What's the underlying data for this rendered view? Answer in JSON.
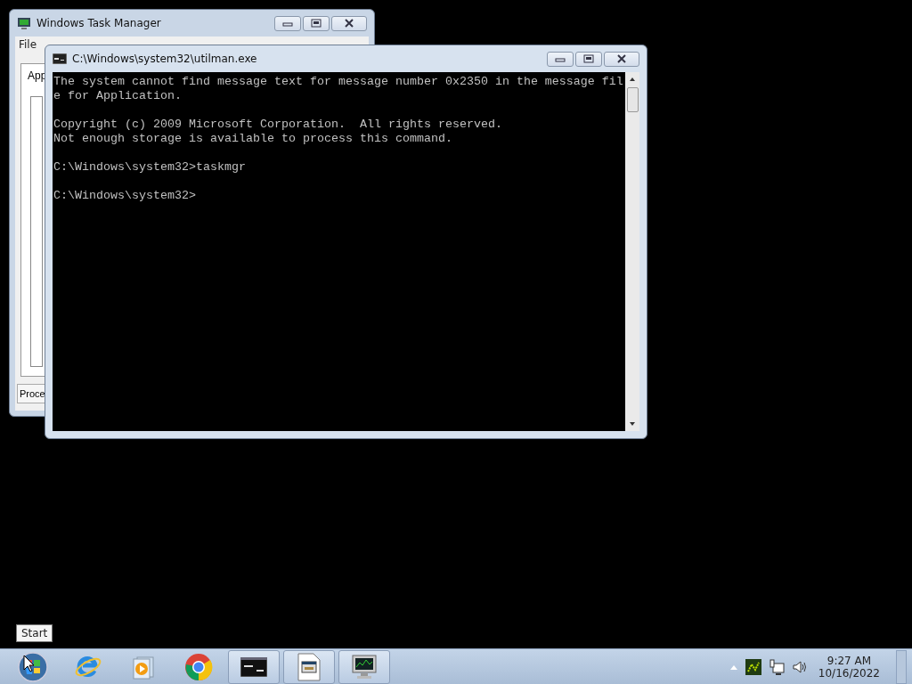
{
  "windows": [
    {
      "kind": "taskmgr",
      "title": "Windows Task Manager",
      "menu": [
        "File"
      ],
      "tab": "App",
      "bottom_button": "Proce"
    },
    {
      "kind": "console",
      "title": "C:\\Windows\\system32\\utilman.exe",
      "blocks": [
        {
          "lines": [
            "The system cannot find message text for message number 0x2350 in the message fil",
            "e for Application."
          ]
        },
        {
          "lines": [
            "Copyright (c) 2009 Microsoft Corporation.  All rights reserved.",
            "Not enough storage is available to process this command."
          ]
        },
        {
          "lines": [
            "C:\\Windows\\system32>taskmgr"
          ]
        },
        {
          "lines": [
            "C:\\Windows\\system32>"
          ]
        }
      ]
    }
  ],
  "tooltip": "Start",
  "taskbar": {
    "items": [
      {
        "kind": "start"
      },
      {
        "kind": "ie"
      },
      {
        "kind": "media"
      },
      {
        "kind": "chrome"
      },
      {
        "kind": "cmd",
        "running": true
      },
      {
        "kind": "doc",
        "running": true
      },
      {
        "kind": "taskmgr",
        "running": true
      }
    ],
    "time": "9:27 AM",
    "date": "10/16/2022"
  }
}
